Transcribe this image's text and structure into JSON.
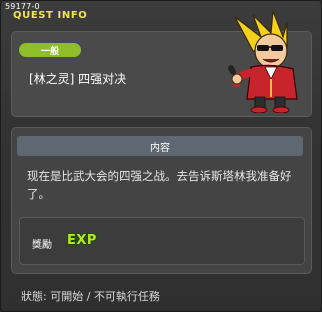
{
  "quest": {
    "id_label": "59177-0",
    "window_title": "QUEST INFO",
    "category": "一般",
    "name": "[林之灵] 四强对决"
  },
  "content": {
    "header": "内容",
    "description": "现在是比武大会的四强之战。去告诉斯塔林我准备好了。"
  },
  "reward": {
    "label": "獎勵",
    "exp_text": "EXP"
  },
  "status": {
    "text": "狀態: 可開始 / 不可執行任務"
  },
  "icons": {
    "character": "blonde-pompadour-character-with-microphone",
    "exp": "exp-icon"
  },
  "colors": {
    "title": "#f2e15a",
    "category_badge": "#8fbe2b",
    "exp": "#b9e81e"
  }
}
